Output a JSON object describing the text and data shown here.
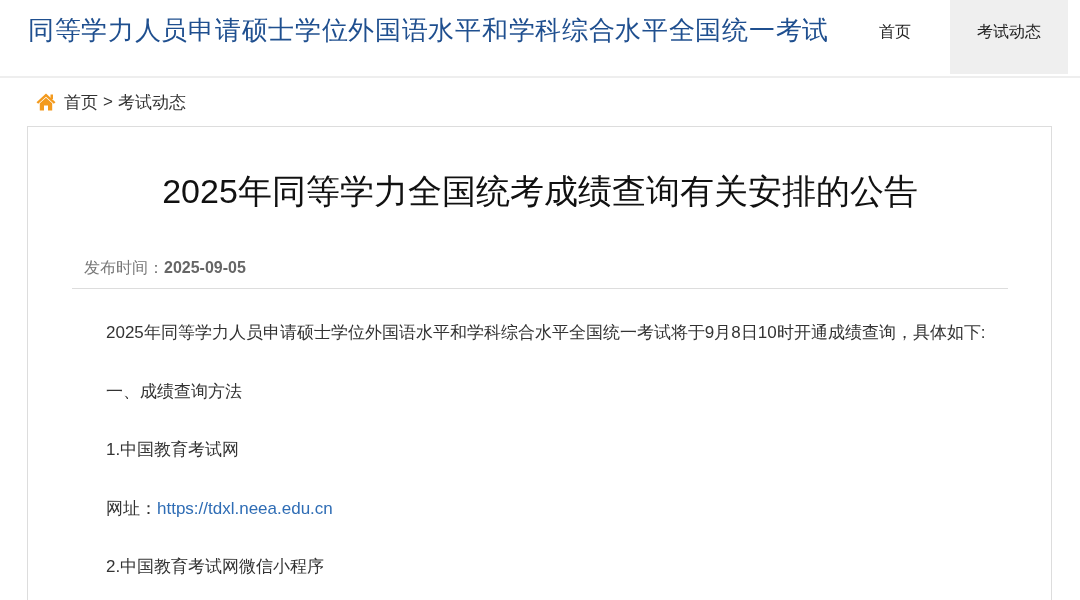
{
  "header": {
    "site_title": "同等学力人员申请硕士学位外国语水平和学科综合水平全国统一考试",
    "nav": [
      {
        "label": "首页",
        "selected": false
      },
      {
        "label": "考试动态",
        "selected": true
      }
    ]
  },
  "breadcrumb": {
    "items": [
      "首页",
      "考试动态"
    ],
    "separator": ">"
  },
  "article": {
    "title": "2025年同等学力全国统考成绩查询有关安排的公告",
    "meta": {
      "label": "发布时间：",
      "date": "2025-09-05"
    },
    "paragraphs": [
      {
        "kind": "text",
        "text": "2025年同等学力人员申请硕士学位外国语水平和学科综合水平全国统一考试将于9月8日10时开通成绩查询，具体如下:"
      },
      {
        "kind": "text",
        "text": "一、成绩查询方法"
      },
      {
        "kind": "text",
        "text": "1.中国教育考试网"
      },
      {
        "kind": "link",
        "label": "网址：",
        "url": "https://tdxl.neea.edu.cn"
      },
      {
        "kind": "text",
        "text": "2.中国教育考试网微信小程序"
      }
    ]
  }
}
